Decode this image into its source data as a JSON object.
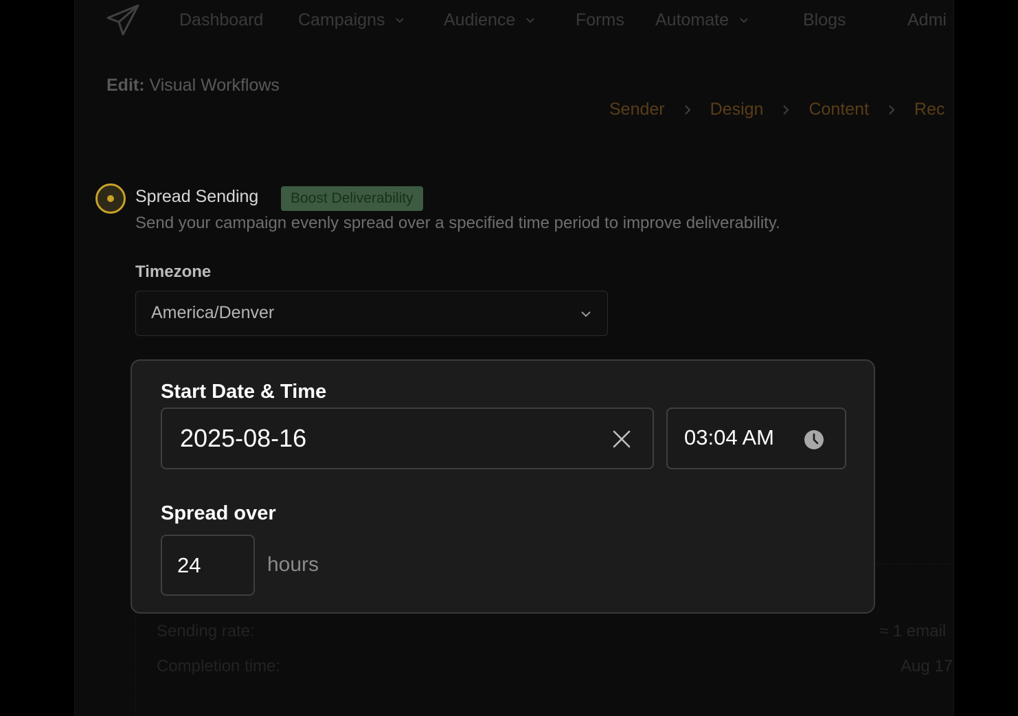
{
  "nav": {
    "items": [
      {
        "label": "Dashboard",
        "has_dropdown": false
      },
      {
        "label": "Campaigns",
        "has_dropdown": true
      },
      {
        "label": "Audience",
        "has_dropdown": true
      },
      {
        "label": "Forms",
        "has_dropdown": false
      },
      {
        "label": "Automate",
        "has_dropdown": true
      },
      {
        "label": "Blogs",
        "has_dropdown": false
      },
      {
        "label": "Admi",
        "has_dropdown": false
      }
    ]
  },
  "page": {
    "edit_prefix": "Edit:",
    "title": "Visual Workflows"
  },
  "steps": [
    "Sender",
    "Design",
    "Content",
    "Rec"
  ],
  "option": {
    "title": "Spread Sending",
    "badge": "Boost Deliverability",
    "description": "Send your campaign evenly spread over a specified time period to improve deliverability.",
    "selected": true
  },
  "timezone": {
    "label": "Timezone",
    "value": "America/Denver"
  },
  "schedule": {
    "start_label": "Start Date & Time",
    "date_value": "2025-08-16",
    "time_value": "03:04 AM",
    "spread_label": "Spread over",
    "hours_value": "24",
    "hours_unit": "hours"
  },
  "summary": {
    "rate_label": "Sending rate:",
    "rate_value": "≈ 1 email",
    "completion_label": "Completion time:",
    "completion_value": "Aug 17"
  },
  "colors": {
    "accent": "#c6822a",
    "radio": "#c9a227",
    "badge_bg": "#3c5b40",
    "badge_text": "#163319"
  }
}
